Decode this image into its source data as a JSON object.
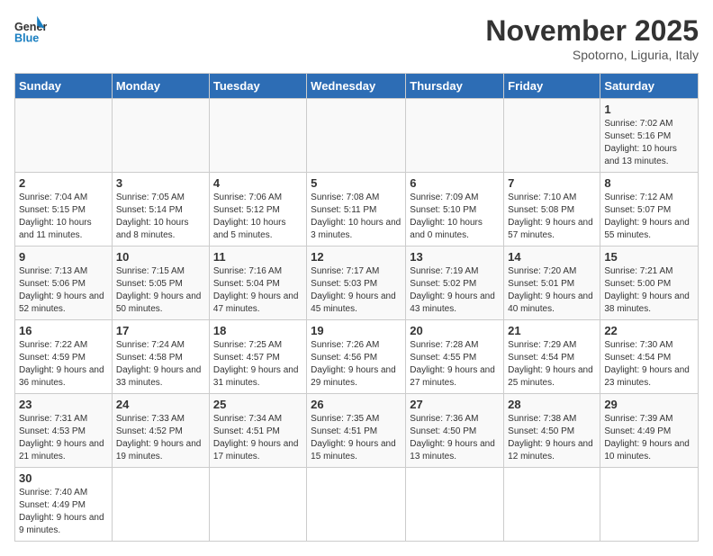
{
  "logo": {
    "text_general": "General",
    "text_blue": "Blue"
  },
  "title": "November 2025",
  "subtitle": "Spotorno, Liguria, Italy",
  "days_of_week": [
    "Sunday",
    "Monday",
    "Tuesday",
    "Wednesday",
    "Thursday",
    "Friday",
    "Saturday"
  ],
  "weeks": [
    [
      {
        "day": "",
        "info": ""
      },
      {
        "day": "",
        "info": ""
      },
      {
        "day": "",
        "info": ""
      },
      {
        "day": "",
        "info": ""
      },
      {
        "day": "",
        "info": ""
      },
      {
        "day": "",
        "info": ""
      },
      {
        "day": "1",
        "info": "Sunrise: 7:02 AM\nSunset: 5:16 PM\nDaylight: 10 hours and 13 minutes."
      }
    ],
    [
      {
        "day": "2",
        "info": "Sunrise: 7:04 AM\nSunset: 5:15 PM\nDaylight: 10 hours and 11 minutes."
      },
      {
        "day": "3",
        "info": "Sunrise: 7:05 AM\nSunset: 5:14 PM\nDaylight: 10 hours and 8 minutes."
      },
      {
        "day": "4",
        "info": "Sunrise: 7:06 AM\nSunset: 5:12 PM\nDaylight: 10 hours and 5 minutes."
      },
      {
        "day": "5",
        "info": "Sunrise: 7:08 AM\nSunset: 5:11 PM\nDaylight: 10 hours and 3 minutes."
      },
      {
        "day": "6",
        "info": "Sunrise: 7:09 AM\nSunset: 5:10 PM\nDaylight: 10 hours and 0 minutes."
      },
      {
        "day": "7",
        "info": "Sunrise: 7:10 AM\nSunset: 5:08 PM\nDaylight: 9 hours and 57 minutes."
      },
      {
        "day": "8",
        "info": "Sunrise: 7:12 AM\nSunset: 5:07 PM\nDaylight: 9 hours and 55 minutes."
      }
    ],
    [
      {
        "day": "9",
        "info": "Sunrise: 7:13 AM\nSunset: 5:06 PM\nDaylight: 9 hours and 52 minutes."
      },
      {
        "day": "10",
        "info": "Sunrise: 7:15 AM\nSunset: 5:05 PM\nDaylight: 9 hours and 50 minutes."
      },
      {
        "day": "11",
        "info": "Sunrise: 7:16 AM\nSunset: 5:04 PM\nDaylight: 9 hours and 47 minutes."
      },
      {
        "day": "12",
        "info": "Sunrise: 7:17 AM\nSunset: 5:03 PM\nDaylight: 9 hours and 45 minutes."
      },
      {
        "day": "13",
        "info": "Sunrise: 7:19 AM\nSunset: 5:02 PM\nDaylight: 9 hours and 43 minutes."
      },
      {
        "day": "14",
        "info": "Sunrise: 7:20 AM\nSunset: 5:01 PM\nDaylight: 9 hours and 40 minutes."
      },
      {
        "day": "15",
        "info": "Sunrise: 7:21 AM\nSunset: 5:00 PM\nDaylight: 9 hours and 38 minutes."
      }
    ],
    [
      {
        "day": "16",
        "info": "Sunrise: 7:22 AM\nSunset: 4:59 PM\nDaylight: 9 hours and 36 minutes."
      },
      {
        "day": "17",
        "info": "Sunrise: 7:24 AM\nSunset: 4:58 PM\nDaylight: 9 hours and 33 minutes."
      },
      {
        "day": "18",
        "info": "Sunrise: 7:25 AM\nSunset: 4:57 PM\nDaylight: 9 hours and 31 minutes."
      },
      {
        "day": "19",
        "info": "Sunrise: 7:26 AM\nSunset: 4:56 PM\nDaylight: 9 hours and 29 minutes."
      },
      {
        "day": "20",
        "info": "Sunrise: 7:28 AM\nSunset: 4:55 PM\nDaylight: 9 hours and 27 minutes."
      },
      {
        "day": "21",
        "info": "Sunrise: 7:29 AM\nSunset: 4:54 PM\nDaylight: 9 hours and 25 minutes."
      },
      {
        "day": "22",
        "info": "Sunrise: 7:30 AM\nSunset: 4:54 PM\nDaylight: 9 hours and 23 minutes."
      }
    ],
    [
      {
        "day": "23",
        "info": "Sunrise: 7:31 AM\nSunset: 4:53 PM\nDaylight: 9 hours and 21 minutes."
      },
      {
        "day": "24",
        "info": "Sunrise: 7:33 AM\nSunset: 4:52 PM\nDaylight: 9 hours and 19 minutes."
      },
      {
        "day": "25",
        "info": "Sunrise: 7:34 AM\nSunset: 4:51 PM\nDaylight: 9 hours and 17 minutes."
      },
      {
        "day": "26",
        "info": "Sunrise: 7:35 AM\nSunset: 4:51 PM\nDaylight: 9 hours and 15 minutes."
      },
      {
        "day": "27",
        "info": "Sunrise: 7:36 AM\nSunset: 4:50 PM\nDaylight: 9 hours and 13 minutes."
      },
      {
        "day": "28",
        "info": "Sunrise: 7:38 AM\nSunset: 4:50 PM\nDaylight: 9 hours and 12 minutes."
      },
      {
        "day": "29",
        "info": "Sunrise: 7:39 AM\nSunset: 4:49 PM\nDaylight: 9 hours and 10 minutes."
      }
    ],
    [
      {
        "day": "30",
        "info": "Sunrise: 7:40 AM\nSunset: 4:49 PM\nDaylight: 9 hours and 9 minutes."
      },
      {
        "day": "",
        "info": ""
      },
      {
        "day": "",
        "info": ""
      },
      {
        "day": "",
        "info": ""
      },
      {
        "day": "",
        "info": ""
      },
      {
        "day": "",
        "info": ""
      },
      {
        "day": "",
        "info": ""
      }
    ]
  ]
}
